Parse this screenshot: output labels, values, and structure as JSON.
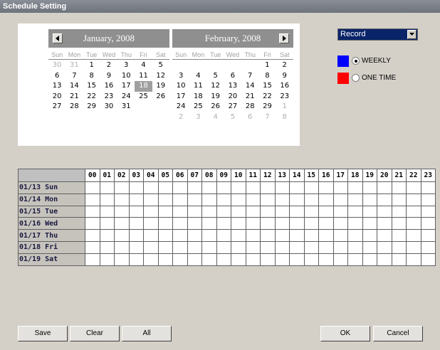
{
  "window": {
    "title": "Schedule Setting"
  },
  "calendar": {
    "months": [
      {
        "title": "January, 2008",
        "weekdays": [
          "Sun",
          "Mon",
          "Tue",
          "Wed",
          "Thu",
          "Fri",
          "Sat"
        ],
        "days": [
          {
            "d": "30",
            "o": true
          },
          {
            "d": "31",
            "o": true
          },
          {
            "d": "1"
          },
          {
            "d": "2"
          },
          {
            "d": "3"
          },
          {
            "d": "4"
          },
          {
            "d": "5"
          },
          {
            "d": "6"
          },
          {
            "d": "7"
          },
          {
            "d": "8"
          },
          {
            "d": "9"
          },
          {
            "d": "10"
          },
          {
            "d": "11"
          },
          {
            "d": "12"
          },
          {
            "d": "13"
          },
          {
            "d": "14"
          },
          {
            "d": "15"
          },
          {
            "d": "16"
          },
          {
            "d": "17"
          },
          {
            "d": "18",
            "s": true
          },
          {
            "d": "19"
          },
          {
            "d": "20"
          },
          {
            "d": "21"
          },
          {
            "d": "22"
          },
          {
            "d": "23"
          },
          {
            "d": "24"
          },
          {
            "d": "25"
          },
          {
            "d": "26"
          },
          {
            "d": "27"
          },
          {
            "d": "28"
          },
          {
            "d": "29"
          },
          {
            "d": "30"
          },
          {
            "d": "31"
          }
        ]
      },
      {
        "title": "February, 2008",
        "weekdays": [
          "Sun",
          "Mon",
          "Tue",
          "Wed",
          "Thu",
          "Fri",
          "Sat"
        ],
        "days": [
          {
            "d": ""
          },
          {
            "d": ""
          },
          {
            "d": ""
          },
          {
            "d": ""
          },
          {
            "d": ""
          },
          {
            "d": "1"
          },
          {
            "d": "2"
          },
          {
            "d": "3"
          },
          {
            "d": "4"
          },
          {
            "d": "5"
          },
          {
            "d": "6"
          },
          {
            "d": "7"
          },
          {
            "d": "8"
          },
          {
            "d": "9"
          },
          {
            "d": "10"
          },
          {
            "d": "11"
          },
          {
            "d": "12"
          },
          {
            "d": "13"
          },
          {
            "d": "14"
          },
          {
            "d": "15"
          },
          {
            "d": "16"
          },
          {
            "d": "17"
          },
          {
            "d": "18"
          },
          {
            "d": "19"
          },
          {
            "d": "20"
          },
          {
            "d": "21"
          },
          {
            "d": "22"
          },
          {
            "d": "23"
          },
          {
            "d": "24"
          },
          {
            "d": "25"
          },
          {
            "d": "26"
          },
          {
            "d": "27"
          },
          {
            "d": "28"
          },
          {
            "d": "29"
          },
          {
            "d": "1",
            "o": true
          },
          {
            "d": "2",
            "o": true
          },
          {
            "d": "3",
            "o": true
          },
          {
            "d": "4",
            "o": true
          },
          {
            "d": "5",
            "o": true
          },
          {
            "d": "6",
            "o": true
          },
          {
            "d": "7",
            "o": true
          },
          {
            "d": "8",
            "o": true
          }
        ]
      }
    ],
    "prev_icon": "arrow-left-icon",
    "next_icon": "arrow-right-icon"
  },
  "mode_select": {
    "value": "Record"
  },
  "legend": {
    "weekly": {
      "label": "WEEKLY",
      "color": "#0000ff",
      "selected": true
    },
    "one_time": {
      "label": "ONE TIME",
      "color": "#ff0000",
      "selected": false
    }
  },
  "schedule": {
    "hours": [
      "00",
      "01",
      "02",
      "03",
      "04",
      "05",
      "06",
      "07",
      "08",
      "09",
      "10",
      "11",
      "12",
      "13",
      "14",
      "15",
      "16",
      "17",
      "18",
      "19",
      "20",
      "21",
      "22",
      "23"
    ],
    "rows": [
      "01/13 Sun",
      "01/14 Mon",
      "01/15 Tue",
      "01/16 Wed",
      "01/17 Thu",
      "01/18 Fri",
      "01/19 Sat"
    ]
  },
  "buttons": {
    "save": "Save",
    "clear": "Clear",
    "all": "All",
    "ok": "OK",
    "cancel": "Cancel"
  }
}
